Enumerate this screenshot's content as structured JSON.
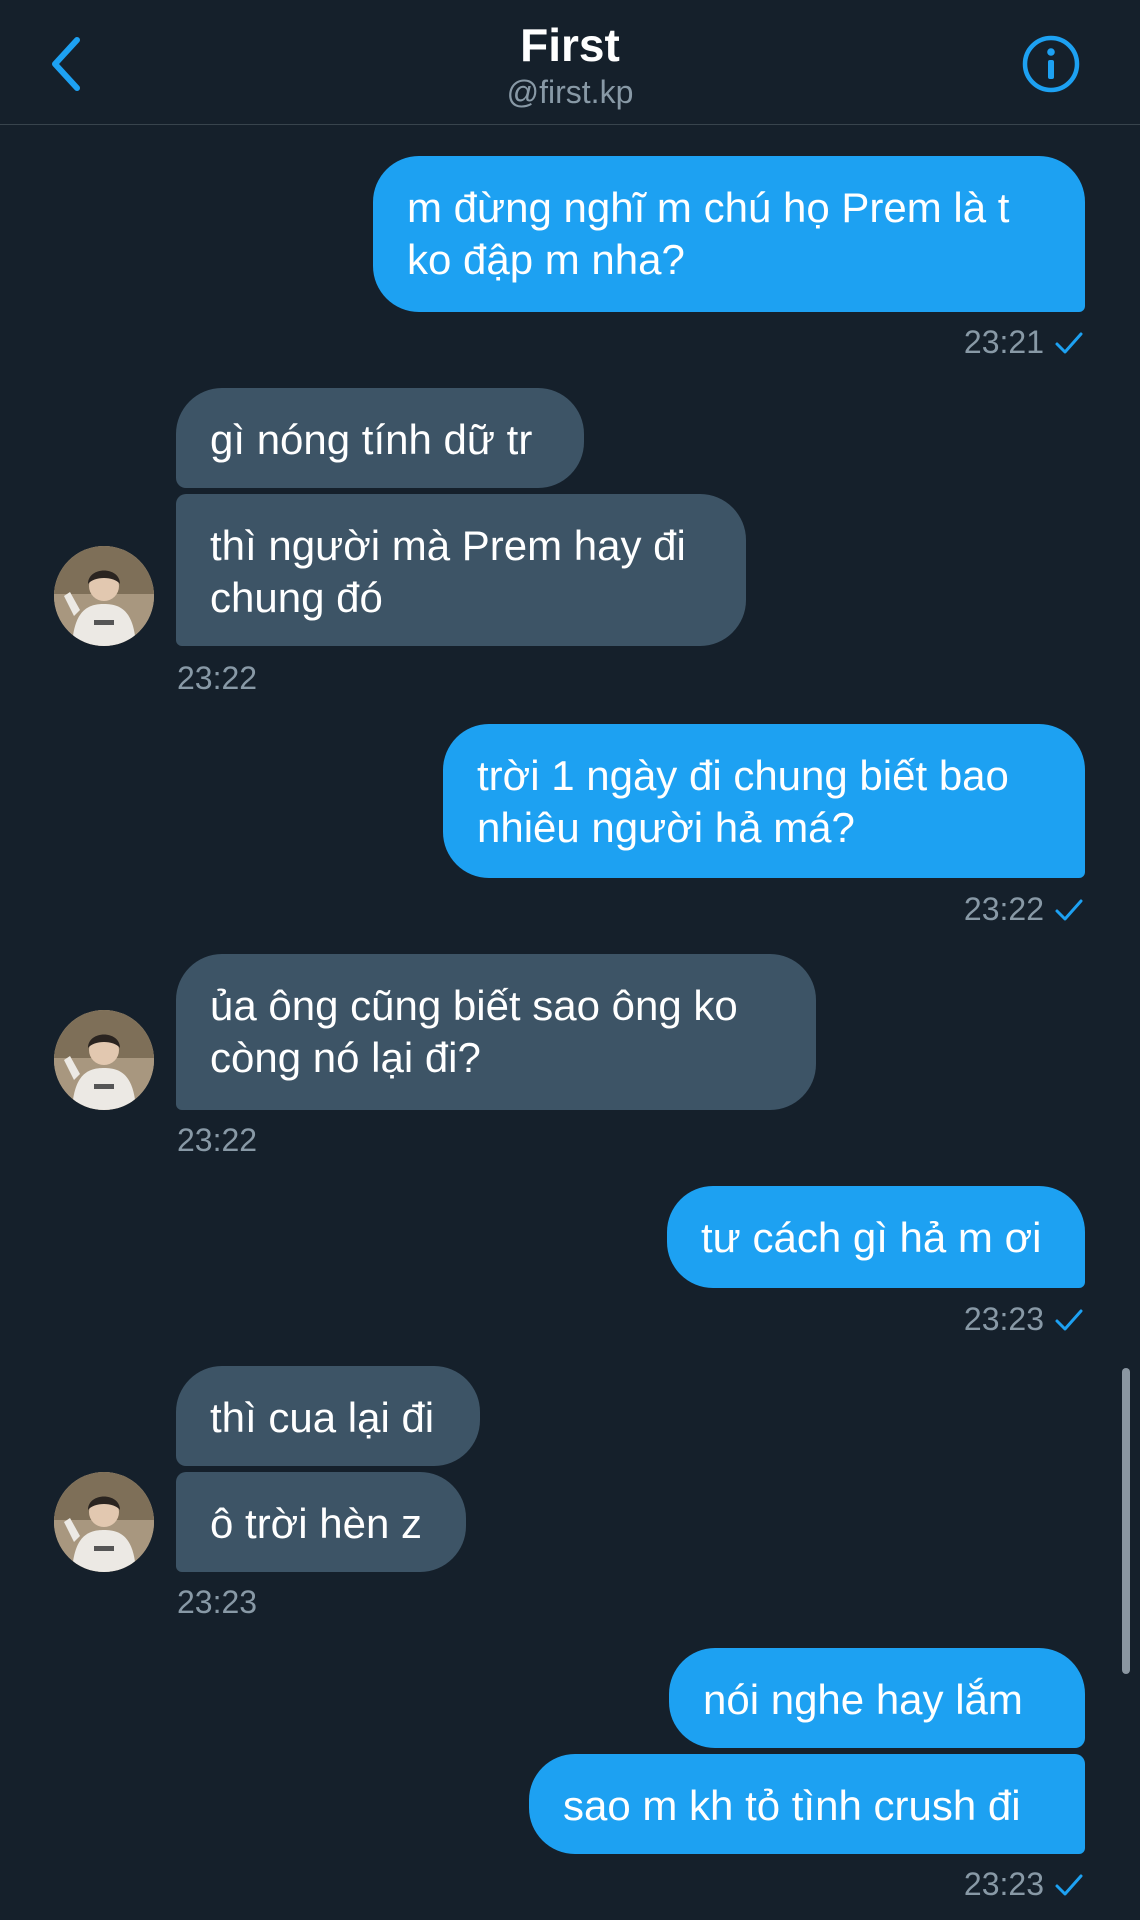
{
  "header": {
    "title": "First",
    "subtitle": "@first.kp",
    "back_icon": "chevron-left-icon",
    "info_icon": "info-circle-icon"
  },
  "colors": {
    "background": "#15202b",
    "accent": "#1da1f2",
    "incoming_bubble": "#3d5466",
    "muted_text": "#8899a6"
  },
  "messages": {
    "m1": {
      "line1": "m đừng nghĩ m chú họ Prem là t",
      "line2": "ko đập m nha?",
      "time": "23:21"
    },
    "m2": {
      "text": "gì nóng tính dữ tr"
    },
    "m3": {
      "line1": "thì người mà Prem hay đi",
      "line2": "chung đó",
      "time": "23:22"
    },
    "m4": {
      "line1": "trời 1 ngày đi chung biết bao",
      "line2": "nhiêu người hả má?",
      "time": "23:22"
    },
    "m5": {
      "line1": "ủa ông cũng biết sao ông ko",
      "line2": "còng nó lại đi?",
      "time": "23:22"
    },
    "m6": {
      "text": "tư cách gì hả m ơi",
      "time": "23:23"
    },
    "m7": {
      "text": "thì cua lại đi"
    },
    "m8": {
      "text": "ô trời hèn z",
      "time": "23:23"
    },
    "m9": {
      "text": "nói nghe hay lắm"
    },
    "m10": {
      "text": "sao m kh tỏ tình crush đi",
      "time": "23:23"
    }
  }
}
